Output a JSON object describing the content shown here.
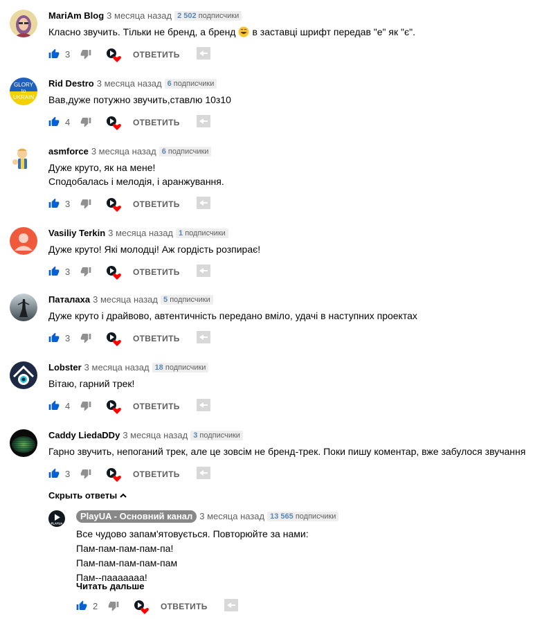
{
  "comments": [
    {
      "author": "MariAm Blog",
      "time": "3 месяца назад",
      "subs_num": "2 502",
      "subs_label": "подписчики",
      "lines": [
        "Класно звучить. Тільки не бренд, а бренд",
        "в заставці шрифт передав \"е\" як \"є\"."
      ],
      "likes": "3",
      "avatar_icon": "woman-portrait-avatar"
    },
    {
      "author": "Rid Destro",
      "time": "3 месяца назад",
      "subs_num": "6",
      "subs_label": "подписчики",
      "lines": [
        "Вав,дуже потужно звучить,ставлю 10з10"
      ],
      "likes": "4",
      "avatar_icon": "glory-to-ukraine-avatar",
      "avatar_text": [
        "GLORY",
        "to",
        "UKRAIN"
      ]
    },
    {
      "author": "asmforce",
      "time": "3 месяца назад",
      "subs_num": "6",
      "subs_label": "подписчики",
      "lines": [
        "Дуже круто, як на мене!",
        "Сподобалась і мелодія, і аранжування."
      ],
      "likes": "3",
      "avatar_icon": "cartoon-thumbs-up-avatar"
    },
    {
      "author": "Vasiliy Terkin",
      "time": "3 месяца назад",
      "subs_num": "1",
      "subs_label": "подписчики",
      "lines": [
        "Дуже круто! Які молодці! Аж гордість розпирає!"
      ],
      "likes": "3",
      "avatar_icon": "default-user-avatar"
    },
    {
      "author": "Паталаха",
      "time": "3 месяца назад",
      "subs_num": "5",
      "subs_label": "подписчики",
      "lines": [
        "Дуже круто і драйвово, автентичність передано вміло, удачі в наступних проектах"
      ],
      "likes": "3",
      "avatar_icon": "figure-silhouette-avatar"
    },
    {
      "author": "Lobster",
      "time": "3 месяца назад",
      "subs_num": "18",
      "subs_label": "подписчики",
      "lines": [
        "Вітаю, гарний трек!"
      ],
      "likes": "4",
      "avatar_icon": "eye-triangle-avatar"
    },
    {
      "author": "Caddy LiedaDDy",
      "time": "3 месяца назад",
      "subs_num": "3",
      "subs_label": "подписчики",
      "lines": [
        "Гарно звучить, непоганий трек, але це зовсім не бренд-трек. Поки пишу коментар, вже забулося звучання"
      ],
      "likes": "3",
      "avatar_icon": "dark-sphere-avatar"
    }
  ],
  "reply_label": "ОТВЕТИТЬ",
  "hide_replies": "Скрыть ответы",
  "reply": {
    "author": "PlayUA - Основний канал",
    "time": "3 месяца назад",
    "subs_num": "13 565",
    "subs_label": "подписчики",
    "lines": [
      "Все чудово запам'ятовується. Повторюйте за нами:",
      "Пам-пам-пам-пам-па!",
      "Пам-пам-пам-пам-пам",
      "Пам--пааааааа!"
    ],
    "read_more": "Читать дальше",
    "likes": "2",
    "avatar_icon": "playua-logo-avatar",
    "avatar_text": "PLAYUA"
  },
  "colors": {
    "like_blue": "#065fd4",
    "heart_red": "#ff0000",
    "meta_gray": "#606060"
  }
}
